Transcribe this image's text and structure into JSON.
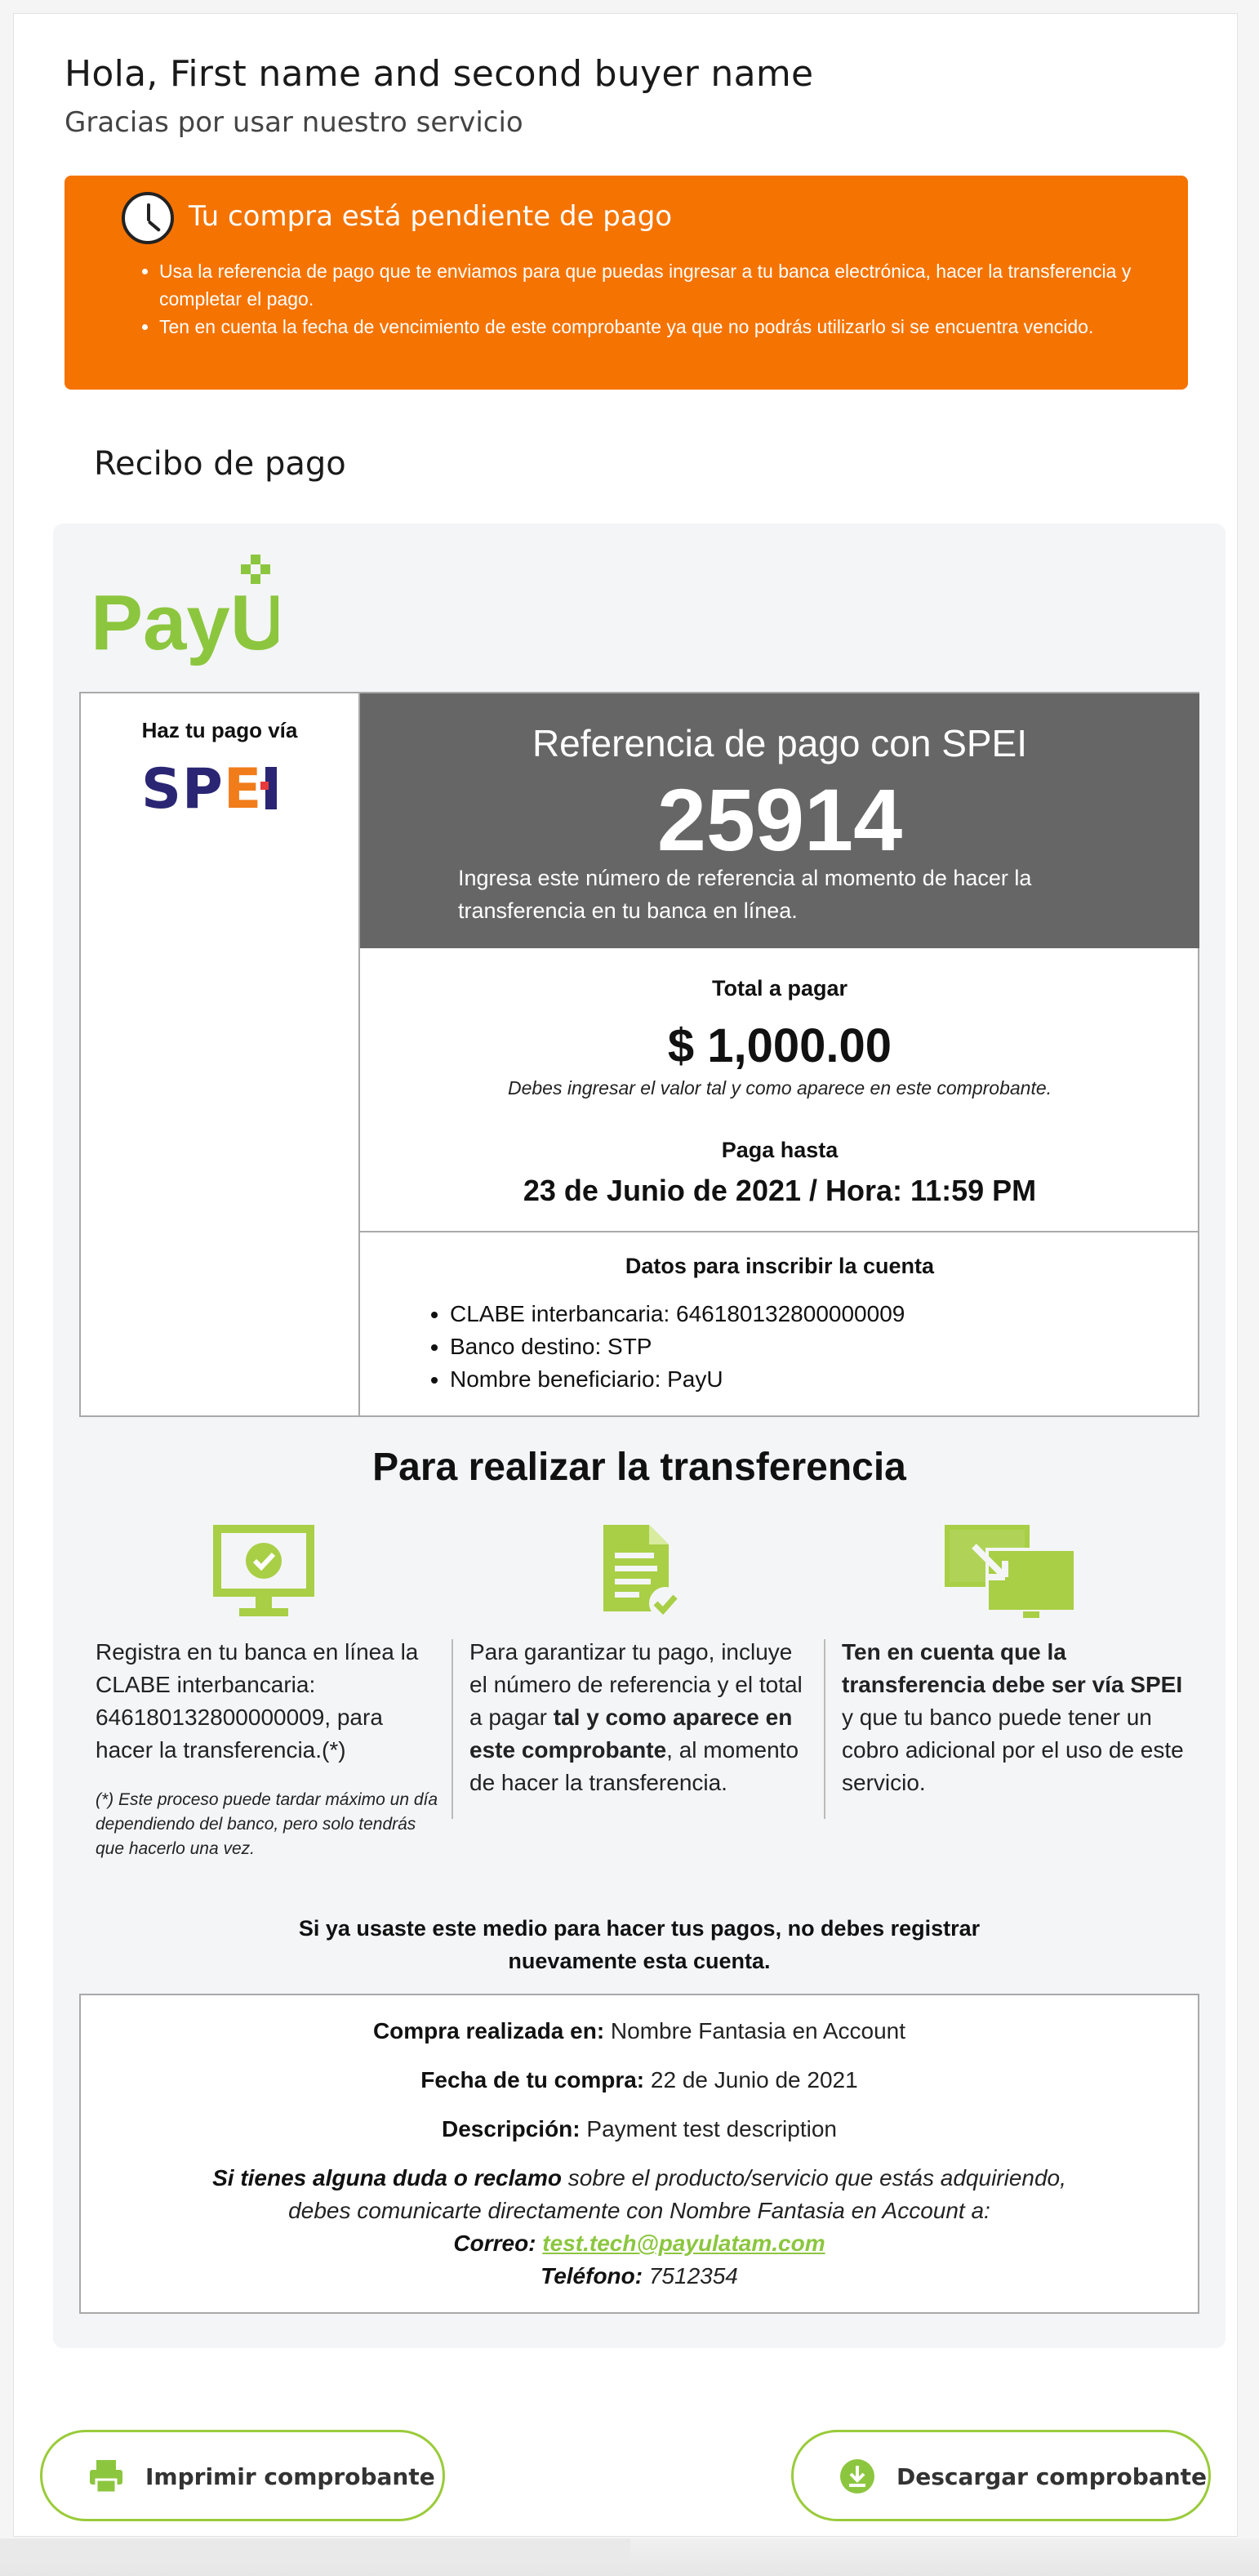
{
  "greeting": {
    "title": "Hola, First name and second buyer name",
    "subtitle": "Gracias por usar nuestro servicio"
  },
  "alert": {
    "icon": "clock-icon",
    "title": "Tu compra está pendiente de pago",
    "items": [
      "Usa la referencia de pago que te enviamos para que puedas ingresar a tu banca electrónica, hacer la transferencia y completar el pago.",
      "Ten en cuenta la fecha de vencimiento de este comprobante ya que no podrás utilizarlo si se encuentra vencido."
    ]
  },
  "receipt": {
    "heading": "Recibo de pago",
    "logo_text": "PayU",
    "pay_via_label": "Haz tu pago vía",
    "spei_logo": "SPEI",
    "reference": {
      "title": "Referencia de pago con SPEI",
      "number": "25914",
      "hint": "Ingresa este número de referencia al momento de hacer la transferencia en tu banca en línea."
    },
    "total": {
      "label": "Total a pagar",
      "amount": "$ 1,000.00",
      "note": "Debes ingresar el valor tal y como aparece en este comprobante.",
      "due_label": "Paga hasta",
      "due_date": "23 de Junio de 2021 / Hora: 11:59 PM"
    },
    "account": {
      "label": "Datos para inscribir la cuenta",
      "items": [
        "CLABE interbancaria: 646180132800000009",
        "Banco destino: STP",
        "Nombre beneficiario: PayU"
      ]
    }
  },
  "steps": {
    "heading": "Para realizar la transferencia",
    "step1": {
      "icon": "monitor-check-icon",
      "text": "Registra en tu banca en línea la CLABE interbancaria: 646180132800000009, para hacer la transferencia.(*)",
      "footnote": "(*) Este proceso puede tardar máximo un día dependiendo del banco, pero solo tendrás que hacerlo una vez."
    },
    "step2": {
      "icon": "document-check-icon",
      "text_a": "Para garantizar tu pago, incluye el número de referencia y el total a pagar ",
      "text_b": "tal y como aparece en este comprobante",
      "text_c": ", al momento de hacer la transferencia."
    },
    "step3": {
      "icon": "monitor-transfer-icon",
      "text_a": "Ten en cuenta que la transferencia debe ser vía SPEI",
      "text_b": " y que tu banco puede tener un cobro adicional por el uso de este servicio."
    }
  },
  "notice": "Si ya usaste este medio para hacer tus pagos, no debes registrar nuevamente esta cuenta.",
  "purchase": {
    "place_label": "Compra realizada en:",
    "place_value": " Nombre Fantasia en Account",
    "date_label": "Fecha de tu compra:",
    "date_value": " 22 de Junio de 2021",
    "desc_label": "Descripción:",
    "desc_value": " Payment test description",
    "doubt_bold": "Si tienes alguna duda o reclamo",
    "doubt_rest": " sobre el producto/servicio que estás adquiriendo,",
    "doubt_line2": "debes comunicarte directamente con Nombre Fantasia en Account a:",
    "email_label": "Correo:",
    "email": "test.tech@payulatam.com",
    "phone_label": "Teléfono:",
    "phone": " 7512354"
  },
  "actions": {
    "print_label": "Imprimir comprobante",
    "download_label": "Descargar comprobante"
  },
  "colors": {
    "accent_orange": "#f57300",
    "payu_green": "#8cc63f",
    "reference_bg": "#666666"
  }
}
